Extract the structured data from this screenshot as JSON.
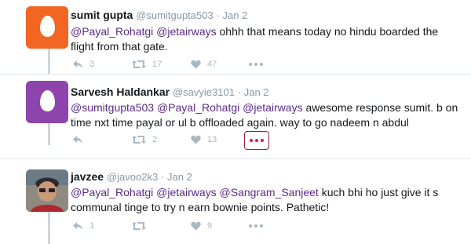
{
  "tweets": [
    {
      "name": "sumit gupta",
      "handle": "@sumitgupta503",
      "date": "· Jan 2",
      "avatar_color": "#f26522",
      "body": [
        {
          "t": "@Payal_Rohatgi",
          "m": true
        },
        {
          "t": " ",
          "m": false
        },
        {
          "t": "@jetairways",
          "m": true
        },
        {
          "t": " ohhh that means today no hindu boarded the flight from that gate.",
          "m": false
        }
      ],
      "replies": "3",
      "retweets": "17",
      "likes": "47"
    },
    {
      "name": "Sarvesh Haldankar",
      "handle": "@savyie3101",
      "date": "· Jan 2",
      "avatar_color": "#8e44ad",
      "body": [
        {
          "t": "@sumitgupta503",
          "m": true
        },
        {
          "t": " ",
          "m": false
        },
        {
          "t": "@Payal_Rohatgi",
          "m": true
        },
        {
          "t": " ",
          "m": false
        },
        {
          "t": "@jetairways",
          "m": true
        },
        {
          "t": " awesome response sumit. b on time nxt time payal or ul b offloaded again. way to go nadeem n abdul",
          "m": false
        }
      ],
      "replies": "",
      "retweets": "2",
      "likes": "13"
    },
    {
      "name": "javzee",
      "handle": "@javoo2k3",
      "date": "· Jan 2",
      "avatar_color": "#7a6a5a",
      "body": [
        {
          "t": "@Payal_Rohatgi",
          "m": true
        },
        {
          "t": " ",
          "m": false
        },
        {
          "t": "@jetairways",
          "m": true
        },
        {
          "t": " ",
          "m": false
        },
        {
          "t": "@Sangram_Sanjeet",
          "m": true
        },
        {
          "t": " kuch bhi ho just give it s communal tinge to try n earn bownie points. Pathetic!",
          "m": false
        }
      ],
      "replies": "1",
      "retweets": "",
      "likes": "9"
    }
  ],
  "colors": {
    "mention": "#5b2a86",
    "icon": "#aab8c2",
    "more_active": "#d41f4a",
    "thread_line": "#ccd6dd"
  }
}
